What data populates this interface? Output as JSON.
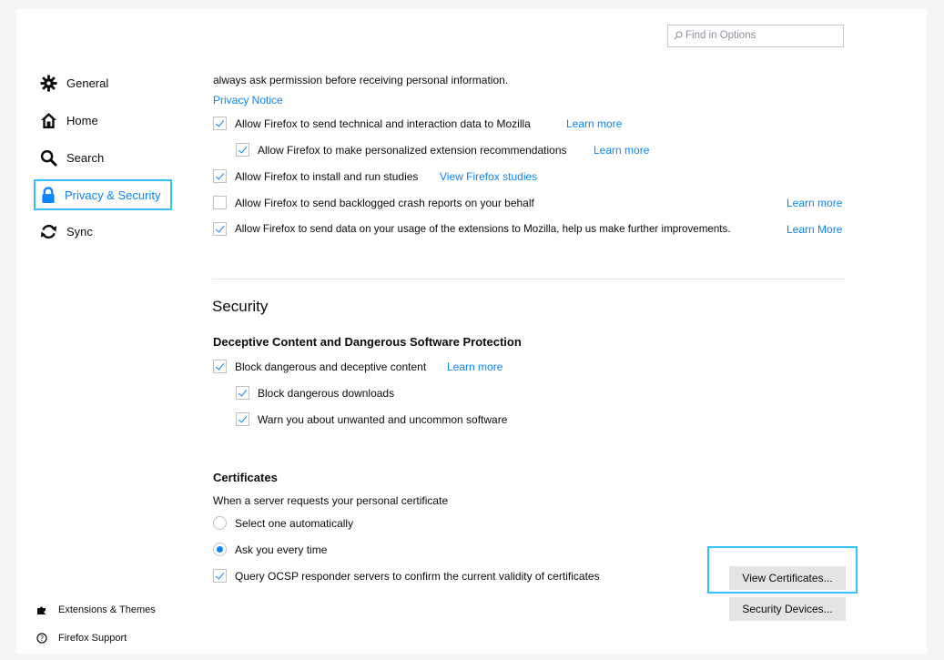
{
  "search": {
    "placeholder": "Find in Options"
  },
  "sidebar": {
    "items": [
      {
        "label": "General",
        "icon": "gear-icon"
      },
      {
        "label": "Home",
        "icon": "home-icon"
      },
      {
        "label": "Search",
        "icon": "search-icon"
      },
      {
        "label": "Privacy & Security",
        "icon": "lock-icon",
        "selected": true
      },
      {
        "label": "Sync",
        "icon": "sync-icon"
      }
    ],
    "footer": [
      {
        "label": "Extensions & Themes",
        "icon": "puzzle-icon"
      },
      {
        "label": "Firefox Support",
        "icon": "help-icon"
      }
    ]
  },
  "data_collection": {
    "intro_text": "always ask permission before receiving personal information.",
    "privacy_notice": "Privacy Notice",
    "options": [
      {
        "label": "Allow Firefox to send technical and interaction data to Mozilla",
        "checked": true,
        "link": "Learn more"
      },
      {
        "label": "Allow Firefox to make personalized extension recommendations",
        "checked": true,
        "link": "Learn more"
      },
      {
        "label": "Allow Firefox to install and run studies",
        "checked": true,
        "link": "View Firefox studies"
      },
      {
        "label": "Allow Firefox to send backlogged crash reports on your behalf",
        "checked": false,
        "link": "Learn more"
      },
      {
        "label": "Allow Firefox to send data on your usage of the extensions to Mozilla, help us make further improvements.",
        "checked": true,
        "link": "Learn More"
      }
    ]
  },
  "security": {
    "title": "Security",
    "deceptive": {
      "heading": "Deceptive Content and Dangerous Software Protection",
      "options": [
        {
          "label": "Block dangerous and deceptive content",
          "checked": true,
          "link": "Learn more"
        },
        {
          "label": "Block dangerous downloads",
          "checked": true
        },
        {
          "label": "Warn you about unwanted and uncommon software",
          "checked": true
        }
      ]
    },
    "certificates": {
      "heading": "Certificates",
      "description": "When a server requests your personal certificate",
      "radio_options": [
        {
          "label": "Select one automatically",
          "selected": false
        },
        {
          "label": "Ask you every time",
          "selected": true
        }
      ],
      "ocsp": {
        "label": "Query OCSP responder servers to confirm the current validity of certificates",
        "checked": true
      },
      "view_button": "View Certificates...",
      "devices_button": "Security Devices..."
    }
  },
  "colors": {
    "accent": "#0a84ff",
    "focus": "#34c3f7",
    "button_bg": "#e4e4e7"
  }
}
